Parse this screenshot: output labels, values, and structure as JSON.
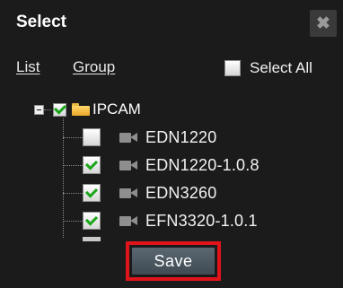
{
  "dialog": {
    "title": "Select",
    "close_glyph": "✖"
  },
  "tabs": {
    "list_label": "List",
    "group_label": "Group"
  },
  "select_all": {
    "label": "Select All",
    "checked": false
  },
  "tree": {
    "root": {
      "label": "IPCAM",
      "checked": true,
      "expanded": true
    },
    "items": [
      {
        "label": "EDN1220",
        "checked": false,
        "icon": "camera-icon"
      },
      {
        "label": "EDN1220-1.0.8",
        "checked": true,
        "icon": "camera-icon"
      },
      {
        "label": "EDN3260",
        "checked": true,
        "icon": "camera-icon"
      },
      {
        "label": "EFN3320-1.0.1",
        "checked": true,
        "icon": "camera-icon"
      }
    ]
  },
  "footer": {
    "save_label": "Save"
  },
  "colors": {
    "highlight": "#e1141b",
    "check": "#1aa61a",
    "button": "#4d5961"
  }
}
